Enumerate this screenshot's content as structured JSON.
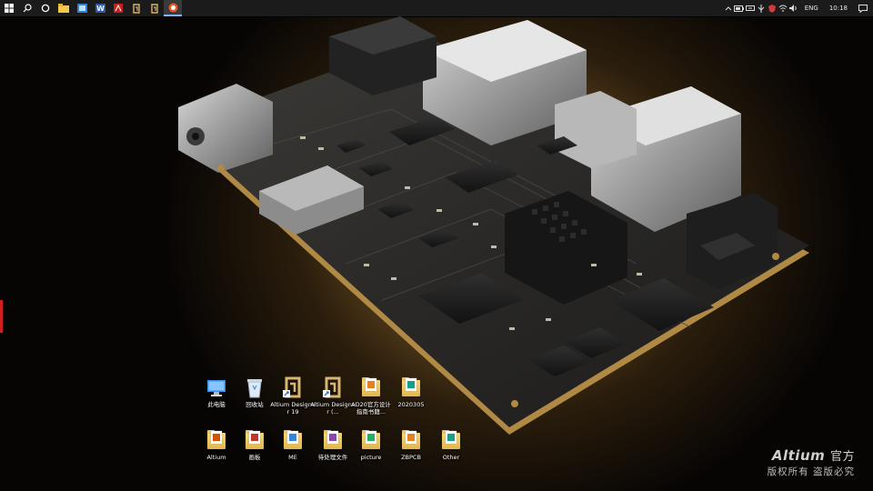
{
  "taskbar": {
    "apps": [
      {
        "name": "start",
        "glyph": "⊞"
      },
      {
        "name": "search",
        "glyph": "⌕"
      },
      {
        "name": "task-view",
        "glyph": "○"
      },
      {
        "name": "file-explorer",
        "glyph": "▬"
      },
      {
        "name": "photos",
        "glyph": "▣"
      },
      {
        "name": "word",
        "glyph": "W"
      },
      {
        "name": "pdf",
        "glyph": "▲"
      },
      {
        "name": "altium-designer-19",
        "glyph": "∂"
      },
      {
        "name": "altium-designer-20",
        "glyph": "∂"
      },
      {
        "name": "active-app",
        "glyph": "◎"
      }
    ],
    "tray": {
      "language": "ENG",
      "time": "10:18"
    }
  },
  "desktop_icons": [
    {
      "id": "this-pc",
      "label": "此电脑",
      "type": "pc"
    },
    {
      "id": "recycle-bin",
      "label": "回收站",
      "type": "bin"
    },
    {
      "id": "altium-designer-19",
      "label": "Altium Designer 19",
      "type": "altium"
    },
    {
      "id": "altium-designer-ellipsis",
      "label": "Altium Designer (...",
      "type": "altium"
    },
    {
      "id": "ad20-doc",
      "label": "AD20官方设计指南书籍...",
      "type": "folder"
    },
    {
      "id": "folder-2020305",
      "label": "2020305",
      "type": "folder"
    },
    {
      "id": "folder-altium",
      "label": "Altium",
      "type": "folder"
    },
    {
      "id": "folder-huaban",
      "label": "画板",
      "type": "folder"
    },
    {
      "id": "folder-me",
      "label": "ME",
      "type": "folder"
    },
    {
      "id": "folder-pending",
      "label": "待处理文件",
      "type": "folder"
    },
    {
      "id": "folder-picture",
      "label": "picture",
      "type": "folder"
    },
    {
      "id": "folder-zbpcb",
      "label": "ZBPCB",
      "type": "folder"
    },
    {
      "id": "folder-other",
      "label": "Other",
      "type": "folder"
    }
  ],
  "watermark": {
    "brand": "Altium",
    "brand_suffix": "官方",
    "subtitle": "版权所有 盗版必究"
  },
  "colors": {
    "taskbar": "#1b1b1b",
    "accent_active": "#7db4ff",
    "background_glow": "#a37a3c",
    "board": "#2b2a29",
    "edge_marker": "#d21e1e"
  }
}
